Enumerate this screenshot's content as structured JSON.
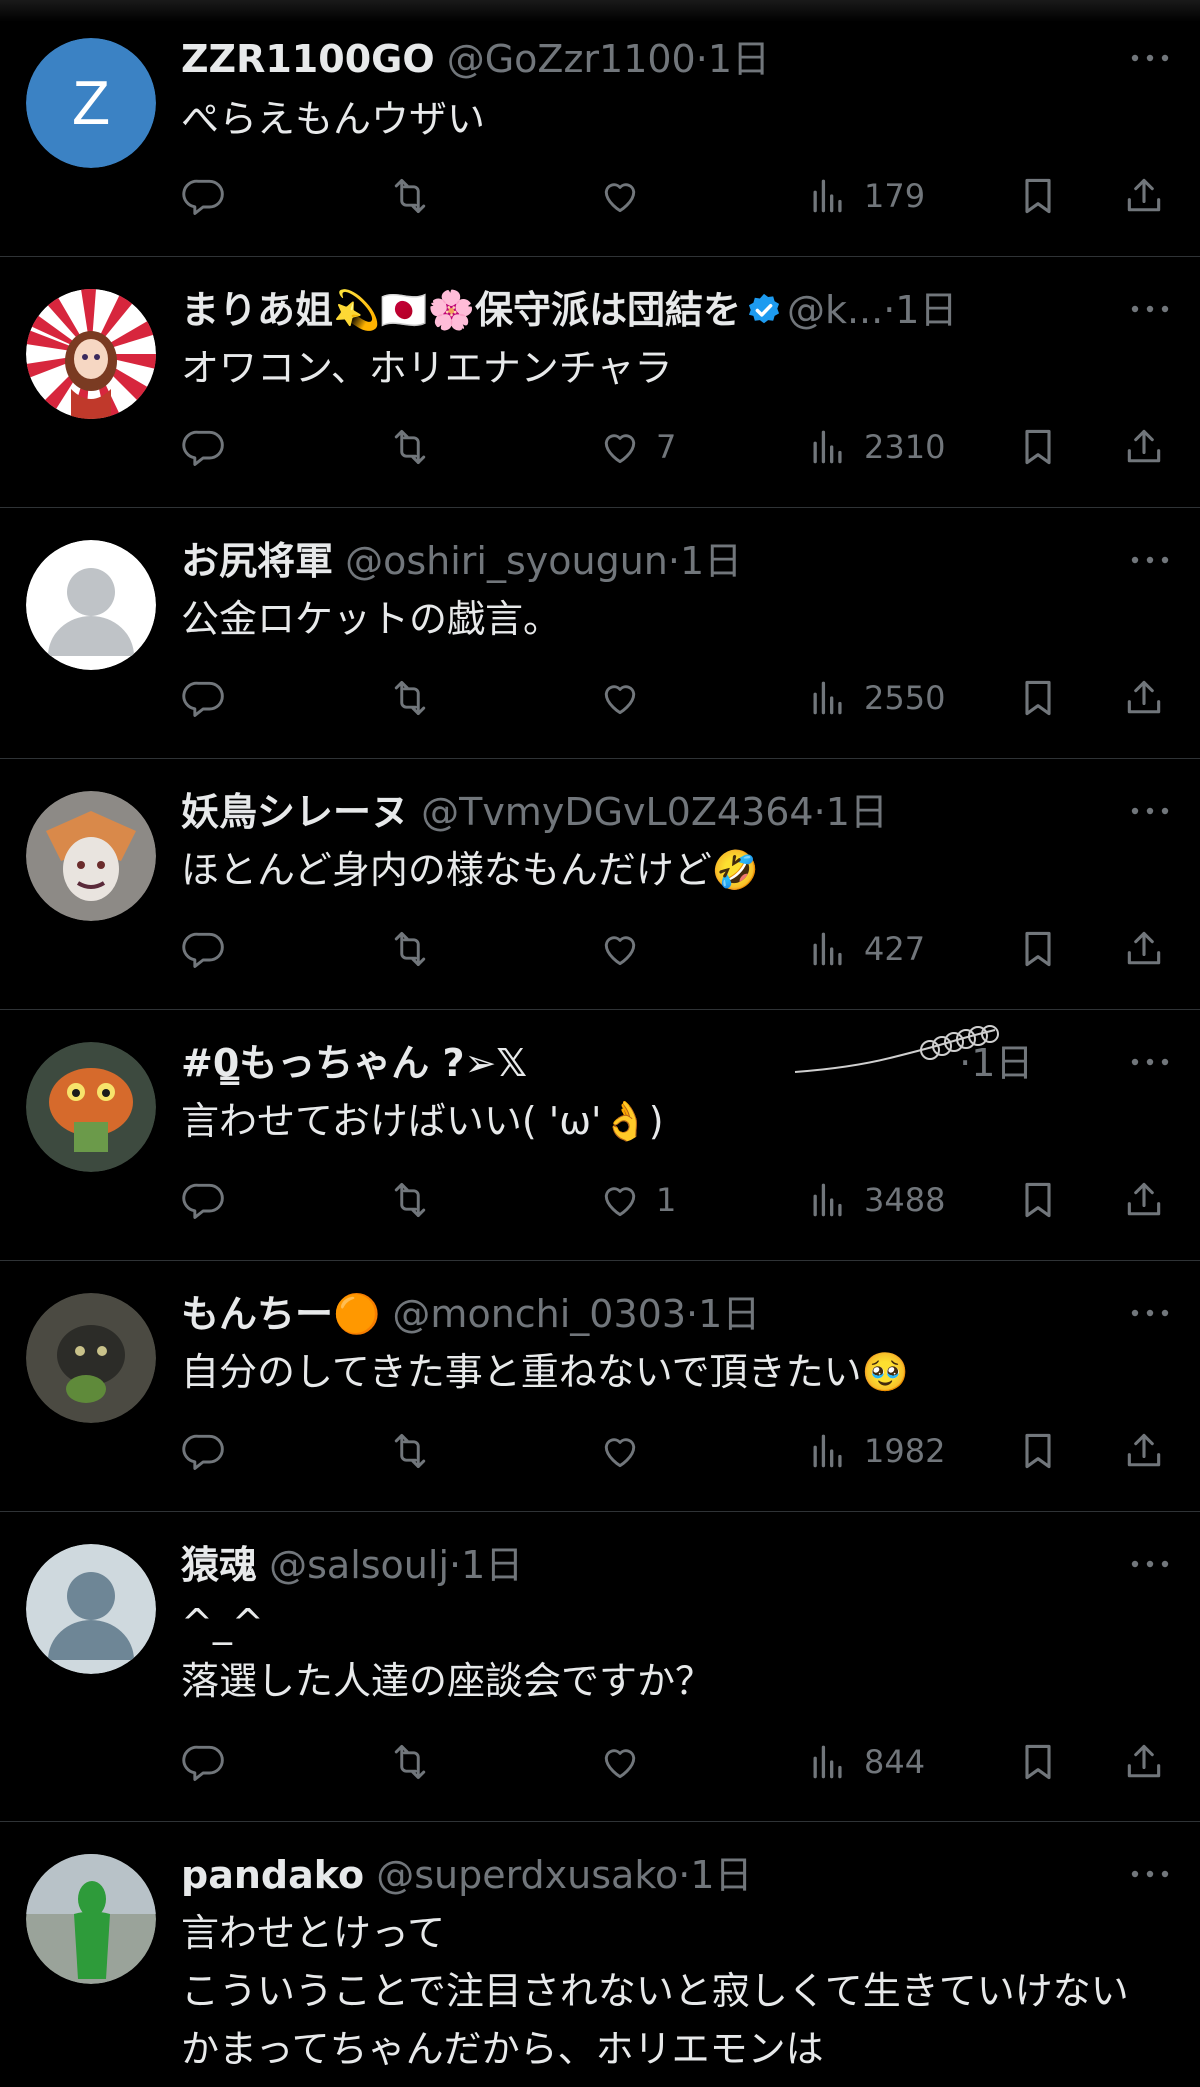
{
  "tweets": [
    {
      "display_name": "ZZR1100GO",
      "handle": "@GoZzr1100",
      "time": "1日",
      "text": "ぺらえもんウザい",
      "avatar_letter": "Z",
      "avatar_color": "#3b82c4",
      "avatar_type": "letter",
      "likes": "",
      "views": "179",
      "name_extras": []
    },
    {
      "display_name": "まりあ姐💫🇯🇵🌸保守派は団結を",
      "handle": "@k...",
      "time": "1日",
      "text": "オワコン、ホリエナンチャラ",
      "avatar_type": "rising-sun",
      "likes": "7",
      "views": "2310",
      "verified": true
    },
    {
      "display_name": "お尻将軍",
      "handle": "@oshiri_syougun",
      "time": "1日",
      "text": "公金ロケットの戯言。",
      "avatar_type": "default-white",
      "likes": "",
      "views": "2550"
    },
    {
      "display_name": "妖鳥シレーヌ",
      "handle": "@TvmyDGvL0Z4364",
      "time": "1日",
      "text": "ほとんど身内の様なもんだけど🤣",
      "avatar_type": "character",
      "likes": "",
      "views": "427"
    },
    {
      "display_name": "#0̳もっちゃん ?➢𝕏",
      "handle": "",
      "time": "1日",
      "text": "言わせておけばいい( 'ω'👌)",
      "avatar_type": "fish",
      "likes": "1",
      "views": "3488"
    },
    {
      "display_name": "もんちー🟠",
      "handle": "@monchi_0303",
      "time": "1日",
      "text": "自分のしてきた事と重ねないで頂きたい🥹",
      "avatar_type": "cat",
      "likes": "",
      "views": "1982"
    },
    {
      "display_name": "猿魂",
      "handle": "@salsoulj",
      "time": "1日",
      "text": "^_^\n落選した人達の座談会ですか？",
      "avatar_type": "default-gray",
      "likes": "",
      "views": "844"
    },
    {
      "display_name": "pandako",
      "handle": "@superdxusako",
      "time": "1日",
      "text": "言わせとけって\nこういうことで注目されないと寂しくて生きていけないかまってちゃんだから、ホリエモンは",
      "avatar_type": "green-figure",
      "likes": "",
      "views": ""
    }
  ],
  "icons": {
    "reply": "reply-icon",
    "retweet": "retweet-icon",
    "like": "like-icon",
    "views": "views-icon",
    "bookmark": "bookmark-icon",
    "share": "share-icon",
    "more": "more-icon",
    "verified": "verified-badge-icon"
  },
  "colors": {
    "background": "#000000",
    "text": "#e7e9ea",
    "secondary": "#71767b",
    "divider": "#2f3336",
    "verified": "#1d9bf0"
  }
}
